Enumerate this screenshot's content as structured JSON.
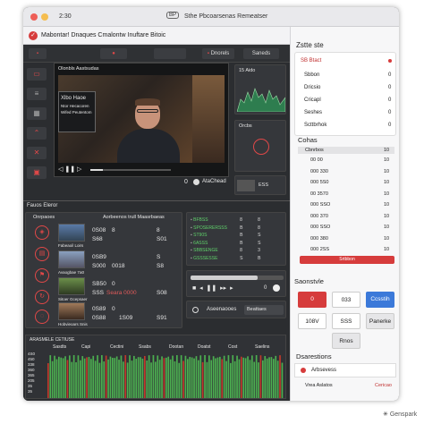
{
  "window": {
    "time": "2:30",
    "title": "Sthe Pbcoarsenas Remeatser",
    "brand_prefix": "BP"
  },
  "subbar": {
    "title": "Mabontar! Dnaques Cmalontw Inuftare Bitoic"
  },
  "tabs": [
    "",
    "",
    "",
    "Dnorels",
    "Saneds"
  ],
  "nav_icons": [
    "sidebar-item-icon",
    "layers-icon",
    "grid-icon",
    "chevron-up-icon",
    "close-icon",
    "image-icon"
  ],
  "video": {
    "header": "Olonbls Aastsudas",
    "slide_line1": "Xlbo Haoe",
    "slide_line2": "Ntor Hecacoren",
    "slide_line3": "Wifed Peutentom",
    "controls_label": "AtaChead",
    "time_mark": "0"
  },
  "chart_panel": {
    "label": "15 Aido"
  },
  "mini_panel": {
    "label": "Orcbs"
  },
  "mini_controls": {
    "ratio": "ESS"
  },
  "section": {
    "label": "Fauos Eleror"
  },
  "list_panel": {
    "tab_label": "Onrpaoes",
    "header": "Aorbeenos trull Maasrbaeas",
    "items": [
      {
        "caption": "Fabeaoil Loirs",
        "v1": "0S08",
        "v2": "8",
        "v3": "S68",
        "v4": "8",
        "v5": "",
        "v6": "S01"
      },
      {
        "caption": "Avaogbae 7a0",
        "v1": "0SB9",
        "v2": "",
        "v3": "S000",
        "v4": "S",
        "v5": "0018",
        "v6": "S8"
      },
      {
        "caption": "Sitoer Gcepsaer",
        "v1": "SB50",
        "v2": "0",
        "v3": "SSS",
        "v4": "",
        "v5": "Seara 0000",
        "v6": "S08"
      },
      {
        "caption": "Hobvieoars Snis",
        "v1": "0S89",
        "v2": "0",
        "v3": "0S88",
        "v4": "",
        "v5": "1S09",
        "v6": "S91"
      }
    ]
  },
  "log_panel": {
    "rows": [
      {
        "a": "BFBSS",
        "b": "8",
        "c": "8"
      },
      {
        "a": "SPOSERERSSS",
        "b": "B",
        "c": "8"
      },
      {
        "a": "ST90S",
        "b": "B",
        "c": "S"
      },
      {
        "a": "6ASSS",
        "b": "B",
        "c": "S"
      },
      {
        "a": "SBBSENGE",
        "b": "8",
        "c": "3"
      },
      {
        "a": "GSSSESSE",
        "b": "S",
        "c": "B"
      }
    ]
  },
  "playbar": {
    "time": "0"
  },
  "footer_ctrl": {
    "label": "Aseenaooes",
    "value": "Beattaes"
  },
  "bottom_chart": {
    "title": "ARASMELE CETIUSE",
    "cols": [
      "Sasdts",
      "Capi",
      "Cectini",
      "Ssabs",
      "Dootan",
      "Doatst",
      "Cost",
      "Saelins"
    ],
    "y_labels": [
      "4S0",
      "450",
      "338",
      "360",
      "365",
      "205",
      "35",
      "35",
      "0"
    ]
  },
  "sidebar": {
    "title": "Zstte ste",
    "badge_label": "SB Btact",
    "items": [
      {
        "label": "Sbbon",
        "value": "0"
      },
      {
        "label": "Dricsio",
        "value": "0"
      },
      {
        "label": "Cricapl",
        "value": "0"
      },
      {
        "label": "Seshes",
        "value": "0"
      },
      {
        "label": "Scttbrhok",
        "value": "0"
      }
    ],
    "section2_title": "Cohas",
    "stats_header": {
      "label": "Cbnrbos",
      "value": "10"
    },
    "stats": [
      {
        "label": "00 00",
        "value": "10"
      },
      {
        "label": "000 330",
        "value": "10"
      },
      {
        "label": "000 5S0",
        "value": "10"
      },
      {
        "label": "00 3570",
        "value": "10"
      },
      {
        "label": "000 SSO",
        "value": "10"
      },
      {
        "label": "000 370",
        "value": "10"
      },
      {
        "label": "000 SSO",
        "value": "10"
      },
      {
        "label": "000 380",
        "value": "10"
      },
      {
        "label": "000 2SS",
        "value": "10"
      }
    ],
    "progress_label": "Srtbbon",
    "section3_title": "Saonstvle",
    "buttons": [
      {
        "label": "0",
        "style": "red"
      },
      {
        "label": "033",
        "style": "light"
      },
      {
        "label": "Ccsstih",
        "style": "blue"
      },
      {
        "label": "108V",
        "style": "light"
      },
      {
        "label": "SSS",
        "style": "light"
      },
      {
        "label": "Panerke",
        "style": "gray"
      }
    ],
    "single_button": "Rnos",
    "section4_title": "Dsarestions",
    "option_label": "Arbsevess",
    "footer_left": "Vrea Aslatos",
    "footer_right": "Cericao"
  },
  "watermark": "Genspark",
  "colors": {
    "accent_red": "#d63c3c",
    "accent_blue": "#3b79d9",
    "accent_green": "#4caf50",
    "panel_dark": "#2b2d30"
  }
}
